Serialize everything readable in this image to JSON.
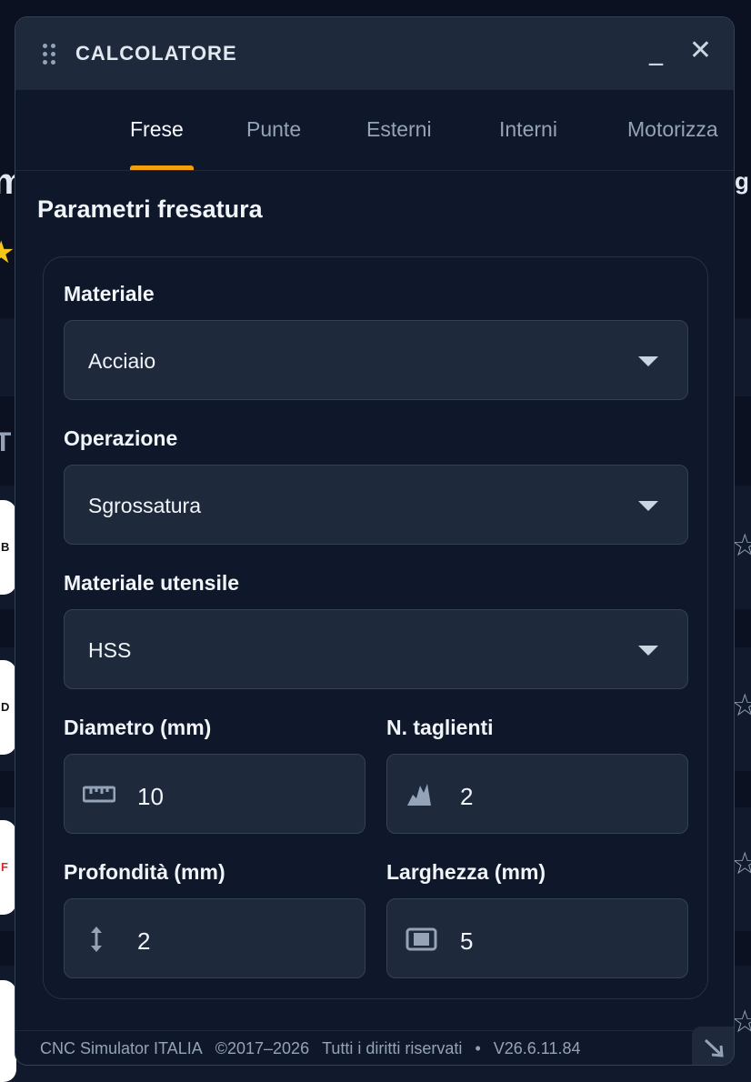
{
  "background": {
    "heading_fragment": "m",
    "tab_fragment": "g",
    "section_fragment": "T",
    "logo_letters": [
      "B",
      "D",
      "F"
    ],
    "star_symbol": "☆"
  },
  "window": {
    "title": "CALCOLATORE",
    "minimize_symbol": "_",
    "close_symbol": "✕"
  },
  "tabs": [
    {
      "label": "Frese",
      "active": true
    },
    {
      "label": "Punte",
      "active": false
    },
    {
      "label": "Esterni",
      "active": false
    },
    {
      "label": "Interni",
      "active": false
    },
    {
      "label": "Motorizza",
      "active": false
    }
  ],
  "form": {
    "title": "Parametri fresatura",
    "material": {
      "label": "Materiale",
      "value": "Acciaio"
    },
    "operation": {
      "label": "Operazione",
      "value": "Sgrossatura"
    },
    "tool_material": {
      "label": "Materiale utensile",
      "value": "HSS"
    },
    "diameter": {
      "label": "Diametro (mm)",
      "value": "10",
      "icon": "ruler-icon"
    },
    "flutes": {
      "label": "N. taglienti",
      "value": "2",
      "icon": "flutes-icon"
    },
    "depth": {
      "label": "Profondità (mm)",
      "value": "2",
      "icon": "vertical-arrows-icon"
    },
    "width": {
      "label": "Larghezza (mm)",
      "value": "5",
      "icon": "width-icon"
    }
  },
  "footer": {
    "brand": "CNC Simulator ITALIA",
    "copyright": "©2017–2026",
    "rights": "Tutti i diritti riservati",
    "separator": "•",
    "version": "V26.6.11.84"
  },
  "colors": {
    "accent": "#f59e0b",
    "panel": "#0f172a",
    "input": "#1e293b",
    "border": "#334155"
  }
}
